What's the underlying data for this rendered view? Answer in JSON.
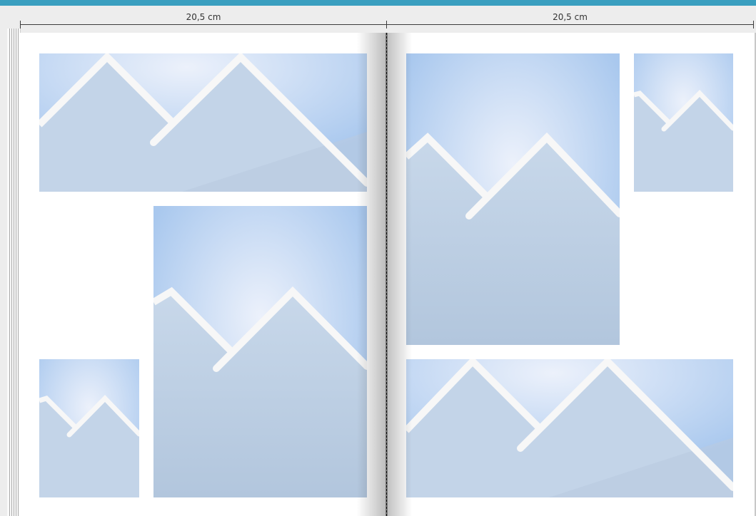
{
  "ruler": {
    "left_width_label": "20,5 cm",
    "right_width_label": "20,5 cm"
  },
  "spread": {
    "left_page": {
      "photo_slots": 3
    },
    "right_page": {
      "photo_slots": 3
    }
  },
  "colors": {
    "accent_bar": "#3a9fc0",
    "placeholder_sky": "#a9c8ee",
    "placeholder_glow": "#e8eefa",
    "placeholder_mountain": "#c2d3e6",
    "placeholder_stroke": "#f7f7f7"
  },
  "icons": {
    "photo_placeholder": "mountain-placeholder-icon"
  }
}
